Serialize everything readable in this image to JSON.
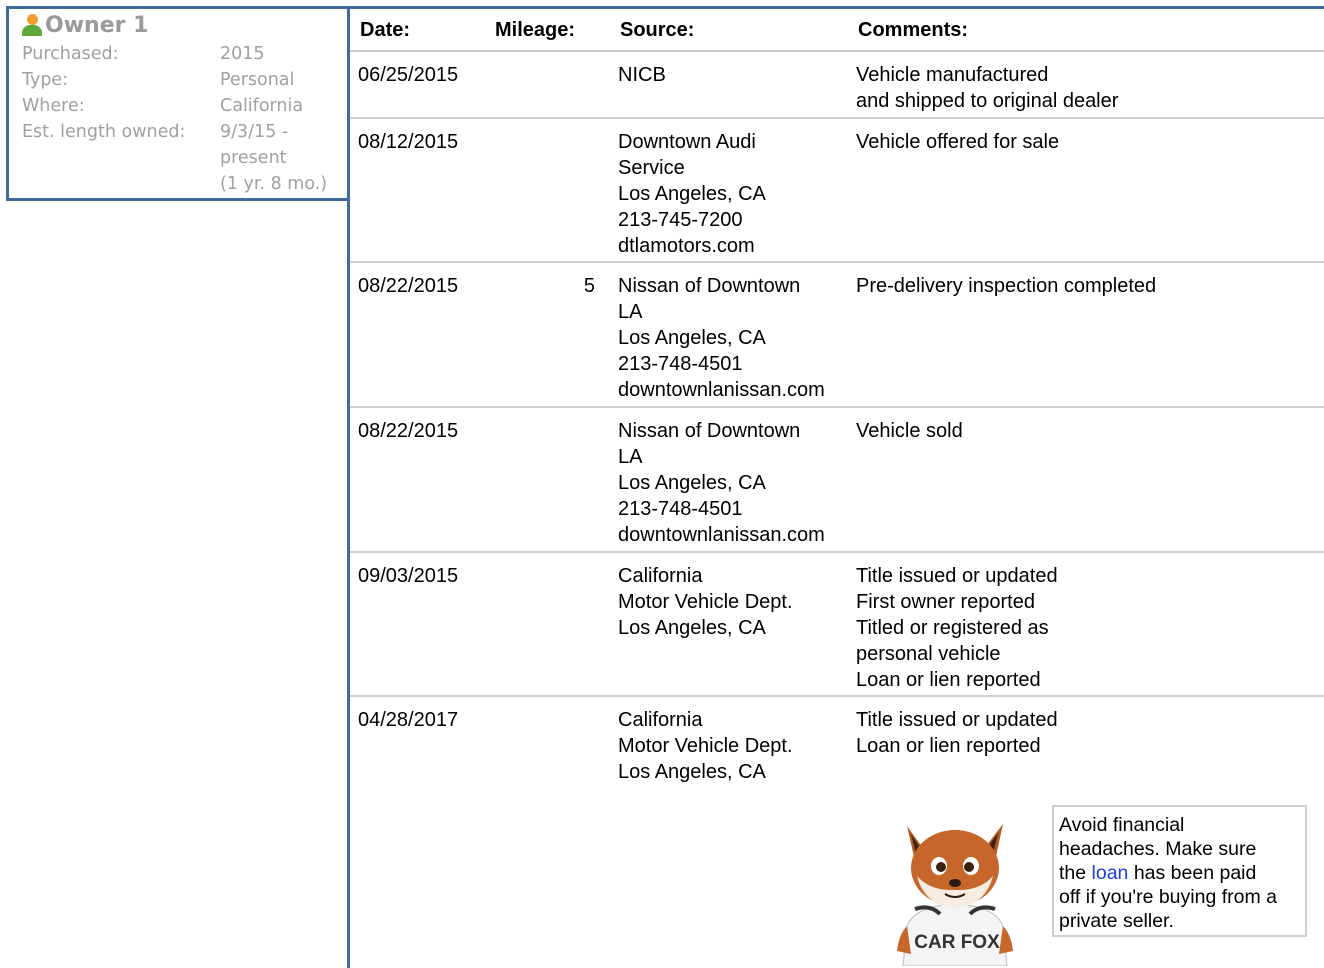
{
  "owner": {
    "title": "Owner 1",
    "rows": [
      {
        "key": "Purchased:",
        "value": [
          "2015"
        ]
      },
      {
        "key": "Type:",
        "value": [
          "Personal"
        ]
      },
      {
        "key": "Where:",
        "value": [
          "California"
        ]
      },
      {
        "key": "Est. length owned:",
        "value": [
          "9/3/15 -",
          "present",
          "(1 yr. 8 mo.)"
        ]
      }
    ]
  },
  "history": {
    "headers": {
      "date": "Date:",
      "mileage": "Mileage:",
      "source": "Source:",
      "comments": "Comments:"
    },
    "rows": [
      {
        "date": "06/25/2015",
        "mileage": "",
        "source": [
          "NICB"
        ],
        "comments": [
          "Vehicle manufactured",
          "and shipped to original dealer"
        ]
      },
      {
        "date": "08/12/2015",
        "mileage": "",
        "source": [
          "Downtown Audi",
          "Service",
          "Los Angeles, CA",
          "213-745-7200",
          "dtlamotors.com"
        ],
        "comments": [
          "Vehicle offered for sale"
        ]
      },
      {
        "date": "08/22/2015",
        "mileage": "5",
        "source": [
          "Nissan of Downtown",
          "LA",
          "Los Angeles, CA",
          "213-748-4501",
          "downtownlanissan.com"
        ],
        "comments": [
          "Pre-delivery inspection completed"
        ]
      },
      {
        "date": "08/22/2015",
        "mileage": "",
        "source": [
          "Nissan of Downtown",
          "LA",
          "Los Angeles, CA",
          "213-748-4501",
          "downtownlanissan.com"
        ],
        "comments": [
          "Vehicle sold"
        ]
      },
      {
        "date": "09/03/2015",
        "mileage": "",
        "source": [
          "California",
          "Motor Vehicle Dept.",
          "Los Angeles, CA"
        ],
        "comments": [
          "Title issued or updated",
          "First owner reported",
          "Titled or registered as",
          "personal vehicle",
          "Loan or lien reported"
        ]
      },
      {
        "date": "04/28/2017",
        "mileage": "",
        "source": [
          "California",
          "Motor Vehicle Dept.",
          "Los Angeles, CA"
        ],
        "comments": [
          "Title issued or updated",
          "Loan or lien reported"
        ]
      }
    ]
  },
  "mascot": {
    "shirt_text": "CAR FOX"
  },
  "tip": {
    "line1": "Avoid financial",
    "line2": "headaches. Make sure",
    "line3_pre": "the ",
    "link": "loan",
    "line3_post": " has been paid",
    "line4": "off if you're buying from a",
    "line5": "private seller."
  },
  "colors": {
    "frame_border": "#3f6c9c",
    "row_divider": "#cfcfcf",
    "owner_text": "#a0a0a0",
    "link": "#1a3fd6"
  }
}
